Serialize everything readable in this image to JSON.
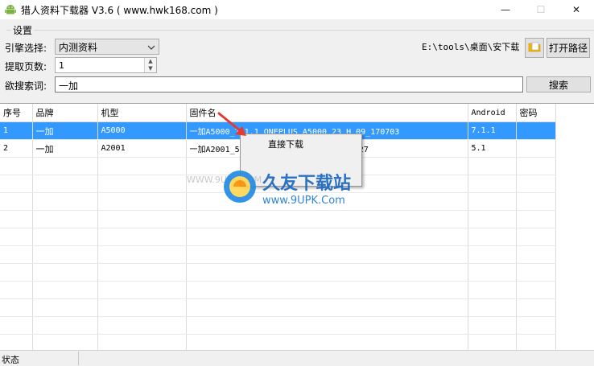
{
  "window": {
    "title": "猎人资料下载器 V3.6 ( www.hwk168.com )",
    "minimize": "—",
    "maximize": "☐",
    "close": "✕"
  },
  "settings": {
    "group_label": "设置",
    "engine_label": "引擎选择:",
    "engine_value": "内测资料",
    "pages_label": "提取页数:",
    "pages_value": "1",
    "keyword_label": "欲搜索词:",
    "keyword_value": "一加",
    "search_button": "搜索",
    "path": "E:\\tools\\桌面\\安下载",
    "open_path_button": "打开路径"
  },
  "table": {
    "headers": [
      "序号",
      "品牌",
      "机型",
      "固件名",
      "Android",
      "密码"
    ],
    "rows": [
      {
        "index": "1",
        "brand": "一加",
        "model": "A5000",
        "firmware": "一加A5000_7.1.1_ONEPLUS_A5000_23_H_09_170703",
        "android": "7.1.1",
        "password": ""
      },
      {
        "index": "2",
        "brand": "一加",
        "model": "A2001",
        "firmware": "一加A2001_5",
        "firmware_tail": "50727",
        "android": "5.1",
        "password": ""
      }
    ]
  },
  "context_menu": {
    "items": [
      "直接下载"
    ]
  },
  "watermark": {
    "brand": "久友下载站",
    "url": "www.9UPK.Com",
    "left_text": "WWW.9UPK.COM"
  },
  "status": {
    "label": "状态"
  },
  "colors": {
    "selection": "#3399ff",
    "window_bg": "#f0f0f0"
  }
}
